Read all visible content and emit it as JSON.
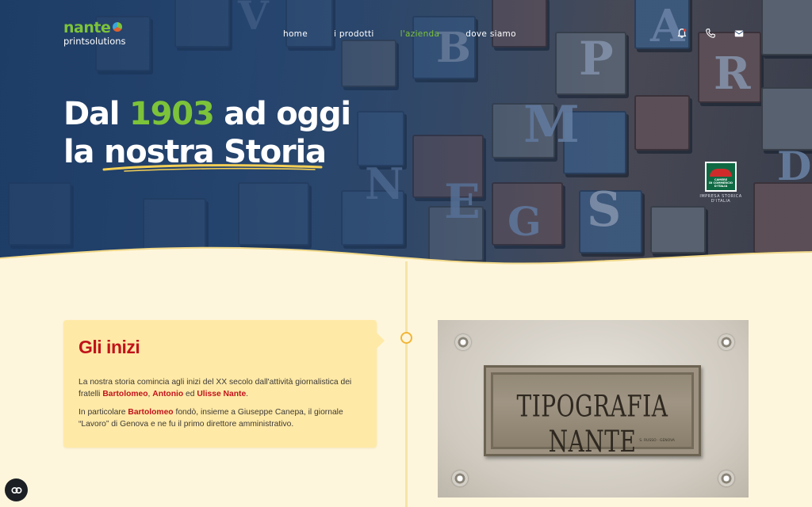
{
  "logo": {
    "brand": "nante",
    "sub": "printsolutions"
  },
  "nav": [
    {
      "label": "home",
      "active": false
    },
    {
      "label": "i prodotti",
      "active": false
    },
    {
      "label": "l'azienda",
      "active": true
    },
    {
      "label": "dove siamo",
      "active": false
    }
  ],
  "actions": {
    "icons": [
      "bell-icon",
      "phone-icon",
      "mail-icon"
    ]
  },
  "hero": {
    "line1_pre": "Dal ",
    "year": "1903",
    "line1_post": " ad oggi",
    "line2_pre": "la ",
    "line2_underlined": "nostra Storia"
  },
  "badge": {
    "text1": "CAMERE",
    "text2": "DI COMMERCIO",
    "text3": "D'ITALIA",
    "caption": "IMPRESA STORICA D'ITALIA"
  },
  "section": {
    "title": "Gli inizi",
    "p1_a": "La nostra storia comincia agli inizi del XX secolo dall'attività giornalistica dei fratelli ",
    "p1_n1": "Bartolomeo",
    "p1_sep1": ", ",
    "p1_n2": "Antonio",
    "p1_sep2": " ed ",
    "p1_n3": "Ulisse Nante",
    "p1_end": ".",
    "p2_a": "In particolare ",
    "p2_n1": "Bartolomeo",
    "p2_b": " fondò, insieme a Giuseppe Canepa, il giornale “Lavoro” di Genova e ne fu il primo direttore amministrativo."
  },
  "photo": {
    "plate_text": "TIPOGRAFIA NANTE",
    "plate_small": "S. RUSSO · GENOVA"
  },
  "colors": {
    "green": "#7cc33a",
    "red": "#c1131b",
    "cream": "#fef6dc",
    "card": "#ffe9a6",
    "timeline": "#f2b534"
  }
}
